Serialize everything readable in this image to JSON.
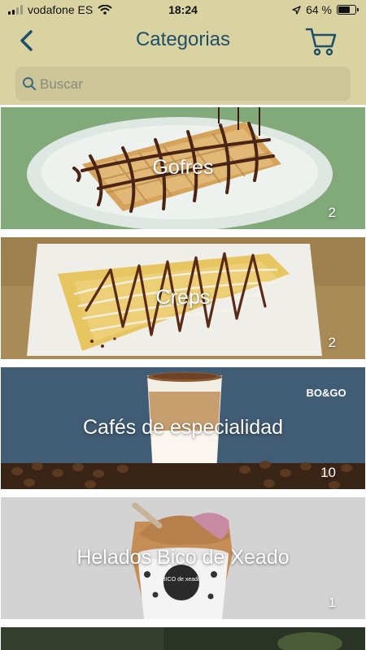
{
  "status_bar": {
    "carrier": "vodafone ES",
    "time": "18:24",
    "battery": "64 %",
    "battery_level": 0.64
  },
  "header": {
    "title": "Categorias"
  },
  "search": {
    "placeholder": "Buscar"
  },
  "categories": [
    {
      "name": "Gofres",
      "count": "2"
    },
    {
      "name": "Creps",
      "count": "2"
    },
    {
      "name": "Cafés de especialidad",
      "count": "10",
      "brand_logo": "BO&GO"
    },
    {
      "name": "Helados Bico de Xeado",
      "count": "1",
      "cup_text": "BICO de xeado"
    }
  ],
  "colors": {
    "header_bg": "#d9d3a2",
    "accent": "#1f4e68"
  }
}
